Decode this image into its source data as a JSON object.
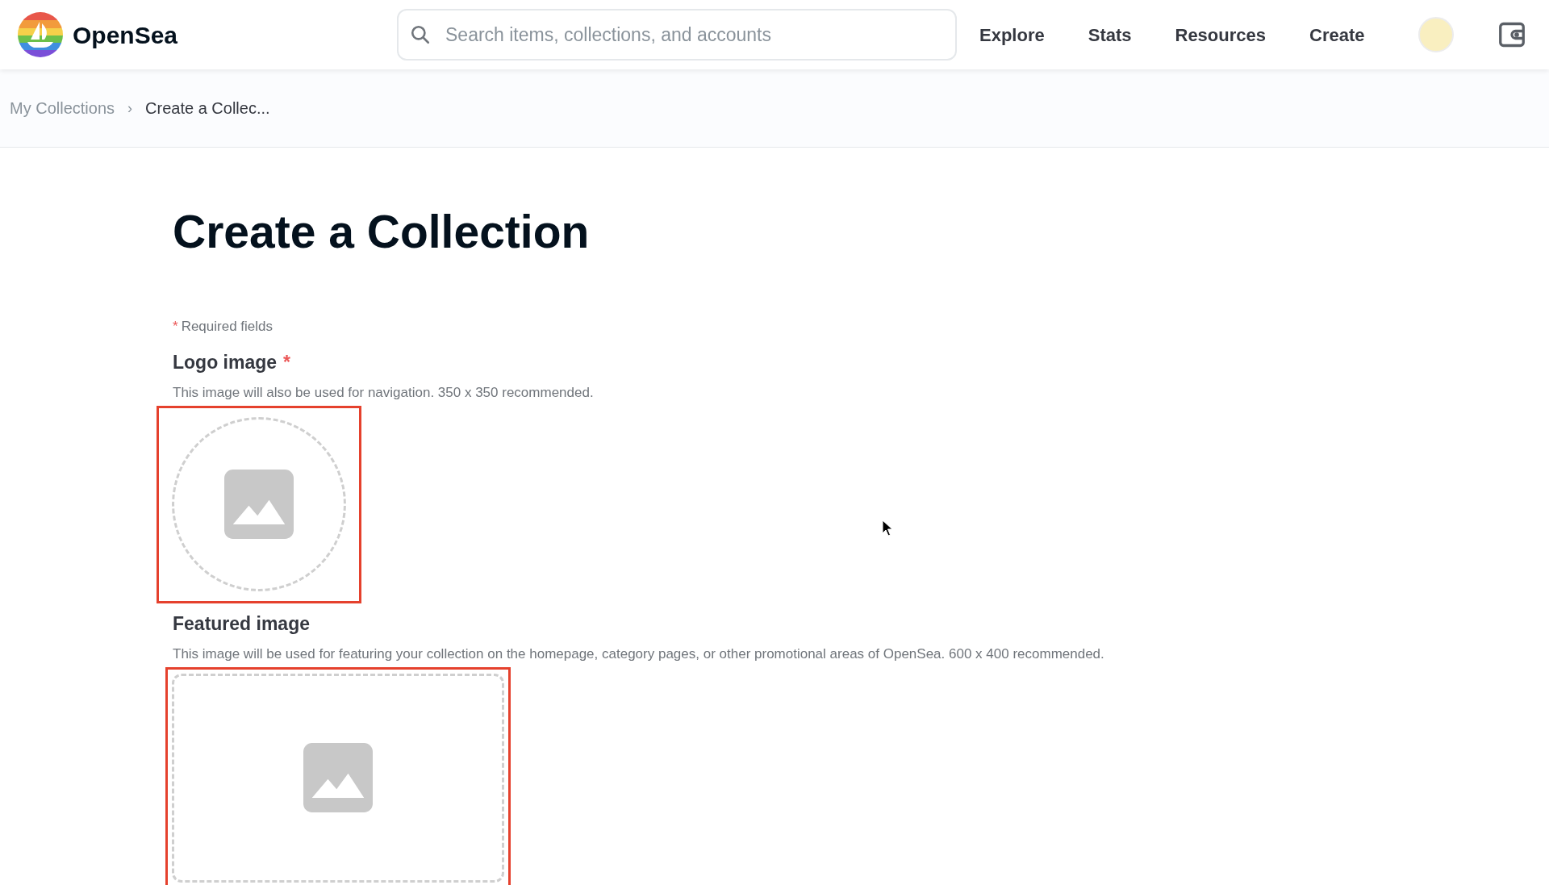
{
  "header": {
    "brand": "OpenSea",
    "search": {
      "placeholder": "Search items, collections, and accounts"
    },
    "nav": [
      "Explore",
      "Stats",
      "Resources",
      "Create"
    ]
  },
  "breadcrumb": [
    {
      "label": "My Collections",
      "current": false
    },
    {
      "label": "Create a Collec...",
      "current": true
    }
  ],
  "separator": "›",
  "title": "Create a Collection",
  "required_note": {
    "mark": "*",
    "text": "Required fields"
  },
  "fields": [
    {
      "label": "Logo image",
      "required": true,
      "description": "This image will also be used for navigation. 350 x 350 recommended.",
      "kind": "circle",
      "highlighted": true
    },
    {
      "label": "Featured image",
      "required": false,
      "description": "This image will be used for featuring your collection on the homepage, category pages, or other promotional areas of OpenSea. 600 x 400 recommended.",
      "kind": "rect",
      "highlighted": true
    }
  ]
}
